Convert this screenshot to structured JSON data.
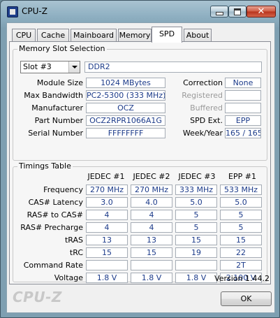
{
  "window": {
    "title": "CPU-Z",
    "controls": {
      "minimize_icon": "minimize-icon",
      "maximize_icon": "maximize-icon",
      "close_icon": "close-icon"
    }
  },
  "tabs": [
    {
      "label": "CPU",
      "active": false
    },
    {
      "label": "Cache",
      "active": false
    },
    {
      "label": "Mainboard",
      "active": false
    },
    {
      "label": "Memory",
      "active": false
    },
    {
      "label": "SPD",
      "active": true
    },
    {
      "label": "About",
      "active": false
    }
  ],
  "memory_slot_selection": {
    "title": "Memory Slot Selection",
    "slot_value": "Slot #3",
    "type_value": "DDR2",
    "rows": [
      {
        "label": "Module Size",
        "value": "1024 MBytes"
      },
      {
        "label": "Max Bandwidth",
        "value": "PC2-5300 (333 MHz)"
      },
      {
        "label": "Manufacturer",
        "value": "OCZ"
      },
      {
        "label": "Part Number",
        "value": "OCZ2RPR1066A1G"
      },
      {
        "label": "Serial Number",
        "value": "FFFFFFFF"
      }
    ],
    "right_rows": [
      {
        "label": "Correction",
        "value": "None",
        "disabled": false
      },
      {
        "label": "Registered",
        "value": "",
        "disabled": true
      },
      {
        "label": "Buffered",
        "value": "",
        "disabled": true
      },
      {
        "label": "SPD Ext.",
        "value": "EPP",
        "disabled": false
      },
      {
        "label": "Week/Year",
        "value": "165 / 165",
        "disabled": false
      }
    ]
  },
  "timings_table": {
    "title": "Timings Table",
    "columns": [
      "JEDEC #1",
      "JEDEC #2",
      "JEDEC #3",
      "EPP #1"
    ],
    "rows": [
      {
        "label": "Frequency",
        "values": [
          "270 MHz",
          "270 MHz",
          "333 MHz",
          "533 MHz"
        ]
      },
      {
        "label": "CAS# Latency",
        "values": [
          "3.0",
          "4.0",
          "5.0",
          "5.0"
        ]
      },
      {
        "label": "RAS# to CAS#",
        "values": [
          "4",
          "4",
          "5",
          "5"
        ]
      },
      {
        "label": "RAS# Precharge",
        "values": [
          "4",
          "4",
          "5",
          "5"
        ]
      },
      {
        "label": "tRAS",
        "values": [
          "13",
          "13",
          "15",
          "15"
        ]
      },
      {
        "label": "tRC",
        "values": [
          "15",
          "15",
          "19",
          "22"
        ]
      },
      {
        "label": "Command Rate",
        "values": [
          "",
          "",
          "",
          "2T"
        ]
      },
      {
        "label": "Voltage",
        "values": [
          "1.8 V",
          "1.8 V",
          "1.8 V",
          "2.100 V"
        ]
      }
    ]
  },
  "footer": {
    "version": "Version 1.44.2",
    "brand": "CPU-Z",
    "ok_label": "OK"
  },
  "colors": {
    "value_text": "#1c3b8a",
    "frame": "#8fb0c2",
    "close_button": "#c9452c"
  }
}
